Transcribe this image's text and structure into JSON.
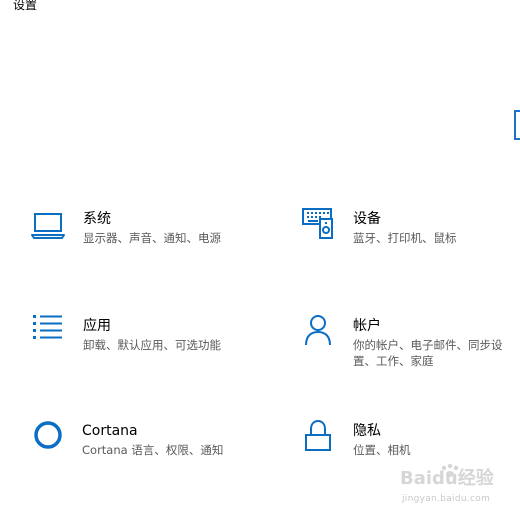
{
  "window": {
    "title": "设置"
  },
  "accent_color": "#0a6ec4",
  "tiles": [
    {
      "icon": "laptop-icon",
      "title": "系统",
      "desc": "显示器、声音、通知、电源"
    },
    {
      "icon": "devices-icon",
      "title": "设备",
      "desc": "蓝牙、打印机、鼠标"
    },
    {
      "icon": "apps-list-icon",
      "title": "应用",
      "desc": "卸载、默认应用、可选功能"
    },
    {
      "icon": "person-icon",
      "title": "帐户",
      "desc": "你的帐户、电子邮件、同步设置、工作、家庭"
    },
    {
      "icon": "cortana-circle-icon",
      "title": "Cortana",
      "desc": "Cortana 语言、权限、通知"
    },
    {
      "icon": "lock-icon",
      "title": "隐私",
      "desc": "位置、相机"
    }
  ],
  "watermark": {
    "brand": "Baidu经验",
    "url": "jingyan.baidu.com"
  }
}
